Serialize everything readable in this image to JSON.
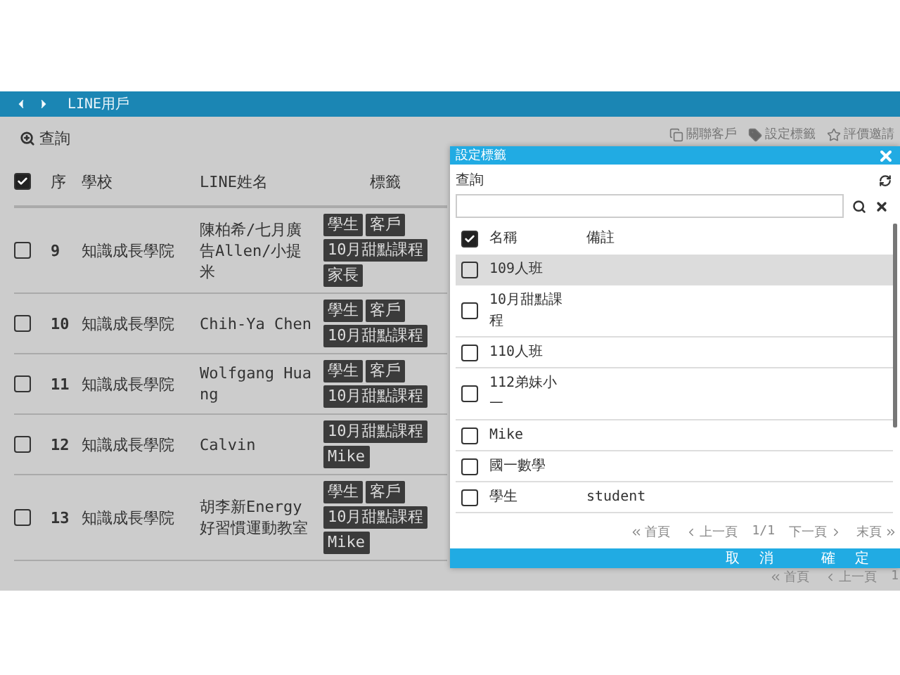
{
  "header": {
    "title": "LINE用戶"
  },
  "toolbar": {
    "search_label": "查詢",
    "actions": [
      {
        "label": "關聯客戶",
        "kind": "link"
      },
      {
        "label": "設定標籤",
        "kind": "tag"
      },
      {
        "label": "評價邀請",
        "kind": "star"
      }
    ]
  },
  "table": {
    "all_checked": true,
    "columns": [
      "序",
      "學校",
      "LINE姓名",
      "標籤"
    ],
    "rows": [
      {
        "checked": false,
        "seq": "9",
        "school": "知識成長學院",
        "name": "陳柏希/七月廣告Allen/小提米",
        "tags": [
          "學生",
          "客戶",
          "10月甜點課程",
          "家長"
        ]
      },
      {
        "checked": false,
        "seq": "10",
        "school": "知識成長學院",
        "name": "Chih-Ya Chen",
        "tags": [
          "學生",
          "客戶",
          "10月甜點課程"
        ]
      },
      {
        "checked": false,
        "seq": "11",
        "school": "知識成長學院",
        "name": "Wolfgang Huang",
        "tags": [
          "學生",
          "客戶",
          "10月甜點課程"
        ]
      },
      {
        "checked": false,
        "seq": "12",
        "school": "知識成長學院",
        "name": "Calvin",
        "tags": [
          "10月甜點課程",
          "Mike"
        ]
      },
      {
        "checked": false,
        "seq": "13",
        "school": "知識成長學院",
        "name": "胡李新Energy好習慣運動教室",
        "tags": [
          "學生",
          "客戶",
          "10月甜點課程",
          "Mike"
        ]
      }
    ]
  },
  "pager": {
    "first": "首頁",
    "prev": "上一頁",
    "page": "1"
  },
  "dialog": {
    "title": "設定標籤",
    "search_label": "查詢",
    "all_checked": true,
    "columns": [
      "名稱",
      "備註"
    ],
    "rows": [
      {
        "name": "109人班",
        "checked": false,
        "selected": true
      },
      {
        "name": "10月甜點課程",
        "checked": false,
        "selected": false
      },
      {
        "name": "110人班",
        "checked": false,
        "selected": false
      },
      {
        "name": "112弟妹小一",
        "checked": false,
        "selected": false
      },
      {
        "name": "Mike",
        "checked": false,
        "selected": false
      },
      {
        "name": "國一數學",
        "checked": false,
        "selected": false
      },
      {
        "name": "學生",
        "note": "student",
        "checked": false,
        "selected": false
      }
    ],
    "pager": {
      "first": "首頁",
      "prev": "上一頁",
      "page": "1/1",
      "next": "下一頁",
      "last": "末頁"
    },
    "buttons": [
      "取消",
      "確定"
    ]
  }
}
